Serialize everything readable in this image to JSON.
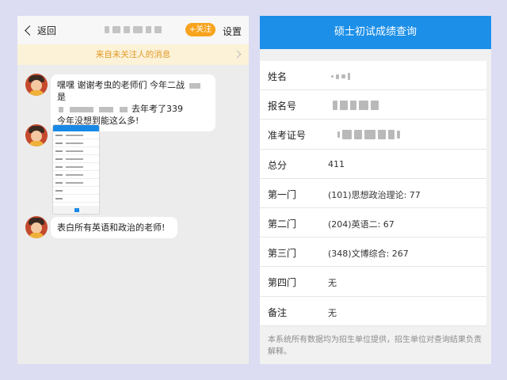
{
  "chat": {
    "back_label": "返回",
    "follow_label": "+关注",
    "settings_label": "设置",
    "notice": "来自未关注人的消息",
    "messages": {
      "m1_part1": "嘿嘿 谢谢考虫的老师们 今年二战",
      "m1_part2": "是",
      "m1_part3": "去年考了339",
      "m1_part4": "今年没想到能这么多!",
      "m3": "表白所有英语和政治的老师!"
    }
  },
  "score_page": {
    "title": "硕士初试成绩查询",
    "rows": [
      {
        "label": "姓名",
        "value": ""
      },
      {
        "label": "报名号",
        "value": ""
      },
      {
        "label": "准考证号",
        "value": ""
      },
      {
        "label": "总分",
        "value": "411"
      },
      {
        "label": "第一门",
        "value": "(101)思想政治理论: 77"
      },
      {
        "label": "第二门",
        "value": "(204)英语二: 67"
      },
      {
        "label": "第三门",
        "value": "(348)文博综合: 267"
      },
      {
        "label": "第四门",
        "value": "无"
      },
      {
        "label": "备注",
        "value": "无"
      }
    ],
    "footnote": "本系统所有数据均为招生单位提供，招生单位对查询结果负责解释。"
  }
}
